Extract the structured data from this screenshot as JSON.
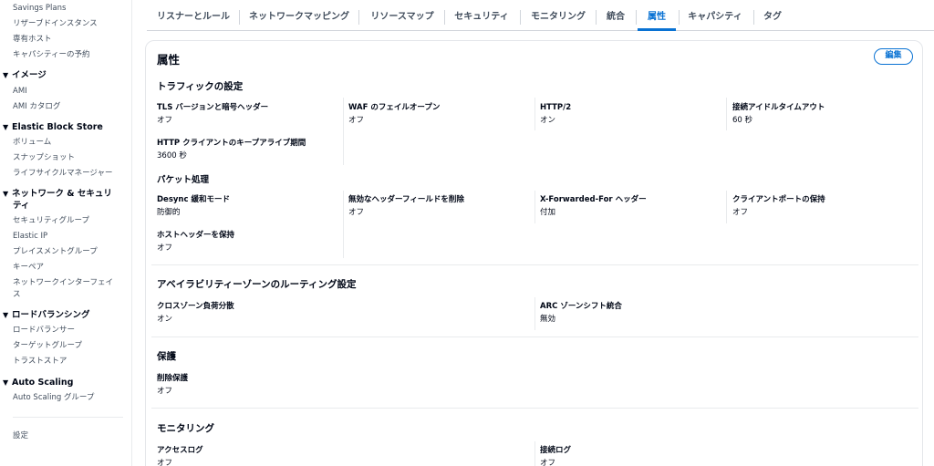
{
  "sidebar": {
    "top_items": [
      "Savings Plans",
      "リザーブドインスタンス",
      "専有ホスト",
      "キャパシティーの予約"
    ],
    "images": {
      "title": "イメージ",
      "items": [
        "AMI",
        "AMI カタログ"
      ]
    },
    "ebs": {
      "title": "Elastic Block Store",
      "items": [
        "ボリューム",
        "スナップショット",
        "ライフサイクルマネージャー"
      ]
    },
    "network": {
      "title_line1": "ネットワーク & セキュリ",
      "title_line2": "ティ",
      "items": [
        "セキュリティグループ",
        "Elastic IP",
        "プレイスメントグループ",
        "キーペア"
      ],
      "eni_line1": "ネットワークインターフェイ",
      "eni_line2": "ス"
    },
    "lb": {
      "title": "ロードバランシング",
      "items": [
        "ロードバランサー",
        "ターゲットグループ",
        "トラストストア"
      ]
    },
    "asg": {
      "title": "Auto Scaling",
      "items": [
        "Auto Scaling グループ"
      ]
    },
    "settings": "設定",
    "toggle_glyph": "▼"
  },
  "tabs": [
    {
      "label": "リスナーとルール"
    },
    {
      "label": "ネットワークマッピング"
    },
    {
      "label": "リソースマップ"
    },
    {
      "label": "セキュリティ"
    },
    {
      "label": "モニタリング"
    },
    {
      "label": "統合"
    },
    {
      "label": "属性"
    },
    {
      "label": "キャパシティ"
    },
    {
      "label": "タグ"
    }
  ],
  "panel": {
    "title": "属性",
    "edit_label": "編集",
    "traffic": {
      "title": "トラフィックの設定",
      "tls": {
        "label": "TLS バージョンと暗号ヘッダー",
        "value": "オフ"
      },
      "waf": {
        "label": "WAF のフェイルオープン",
        "value": "オフ"
      },
      "http2": {
        "label": "HTTP/2",
        "value": "オン"
      },
      "idle": {
        "label": "接続アイドルタイムアウト",
        "value": "60 秒"
      },
      "keepalive": {
        "label": "HTTP クライアントのキープアライブ期間",
        "value": "3600 秒"
      }
    },
    "packet": {
      "title": "パケット処理",
      "desync": {
        "label": "Desync 緩和モード",
        "value": "防御的"
      },
      "drop_invalid": {
        "label": "無効なヘッダーフィールドを削除",
        "value": "オフ"
      },
      "xff": {
        "label": "X-Forwarded-For ヘッダー",
        "value": "付加"
      },
      "client_port": {
        "label": "クライアントポートの保持",
        "value": "オフ"
      },
      "host_header": {
        "label": "ホストヘッダーを保持",
        "value": "オフ"
      }
    },
    "az": {
      "title": "アベイラビリティーゾーンのルーティング設定",
      "cross_zone": {
        "label": "クロスゾーン負荷分散",
        "value": "オン"
      },
      "arc": {
        "label": "ARC ゾーンシフト統合",
        "value": "無効"
      }
    },
    "protection": {
      "title": "保護",
      "deletion": {
        "label": "削除保護",
        "value": "オフ"
      }
    },
    "monitoring": {
      "title": "モニタリング",
      "access_log": {
        "label": "アクセスログ",
        "value": "オフ"
      },
      "conn_log": {
        "label": "接続ログ",
        "value": "オフ"
      }
    }
  }
}
